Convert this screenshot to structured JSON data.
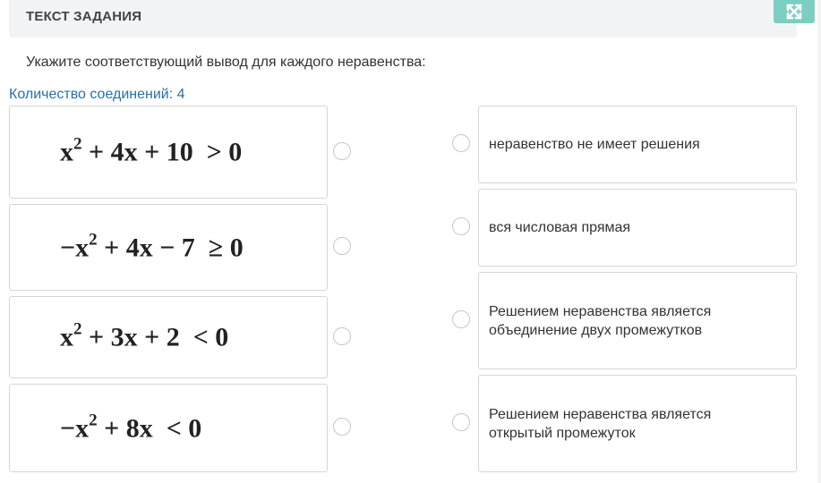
{
  "header": {
    "title": "ТЕКСТ ЗАДАНИЯ",
    "expand_icon": "expand-arrows-icon",
    "accent": "#7ccfc0"
  },
  "instruction": "Укажите соответствующий вывод для каждого неравенства:",
  "connections_label": "Количество соединений: 4",
  "formulas": [
    {
      "pre": "x",
      "pow": "2",
      "post": " + 4x + 10  > 0"
    },
    {
      "pre": "−x",
      "pow": "2",
      "post": " + 4x − 7  ≥ 0"
    },
    {
      "pre": "x",
      "pow": "2",
      "post": " + 3x + 2  < 0"
    },
    {
      "pre": "−x",
      "pow": "2",
      "post": " + 8x  < 0"
    }
  ],
  "answers": [
    {
      "line1": "неравенство не имеет решения",
      "line2": ""
    },
    {
      "line1": "вся числовая прямая",
      "line2": ""
    },
    {
      "line1": "Решением неравенства является",
      "line2": "объединение двух промежутков"
    },
    {
      "line1": "Решением неравенства является",
      "line2": "открытый промежуток"
    }
  ]
}
